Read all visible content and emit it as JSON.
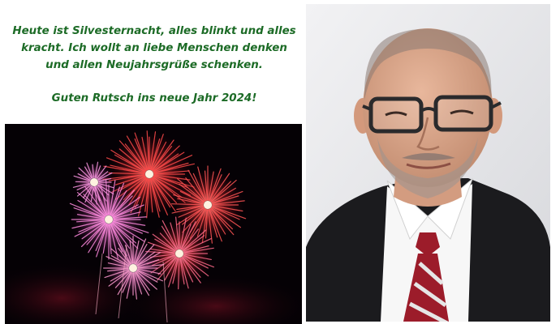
{
  "greeting": {
    "line1": "Heute ist Silvesternacht, alles blinkt und alles",
    "line2": "kracht. Ich wollt an liebe Menschen denken",
    "line3": "und allen Neujahrsgrüße schenken.",
    "wish": "Guten Rutsch ins neue Jahr 2024!"
  },
  "images": {
    "fireworks": "fireworks-photo",
    "portrait": "portrait-photo"
  },
  "colors": {
    "greeting_text": "#1c6b26",
    "fireworks_bg": "#050105",
    "portrait_bg": "#e9e9eb",
    "burst_red": "#ff3b3b",
    "burst_pink": "#ff7ad9",
    "suit": "#1b1b1e",
    "tie_red": "#9c1c2a"
  }
}
